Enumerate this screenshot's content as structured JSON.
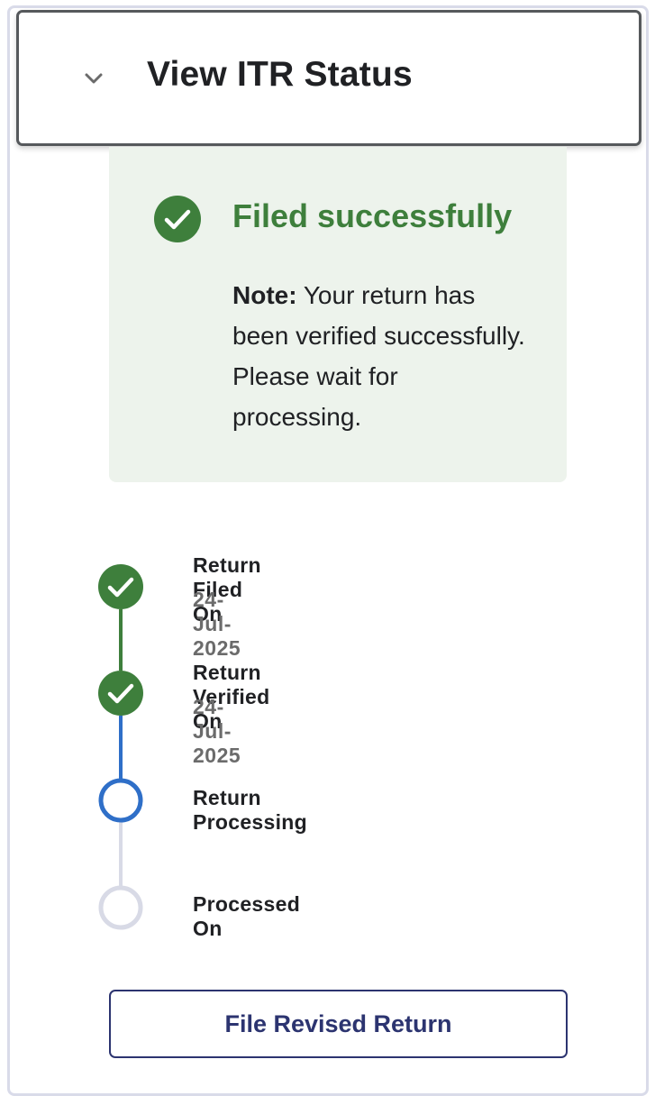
{
  "header": {
    "title": "View ITR Status",
    "toggle_icon": "chevron-down-icon"
  },
  "status_card": {
    "icon": "check-circle-icon",
    "title": "Filed successfully",
    "note_label": "Note:",
    "note_text": " Your return has been verified successfully. Please wait for processing."
  },
  "timeline": {
    "steps": [
      {
        "label": "Return Filed On",
        "date": "24-Jul-2025",
        "state": "completed"
      },
      {
        "label": "Return Verified On",
        "date": "24-Jul-2025",
        "state": "completed"
      },
      {
        "label": "Return Processing",
        "date": "",
        "state": "in-progress"
      },
      {
        "label": "Processed On",
        "date": "",
        "state": "pending"
      }
    ]
  },
  "actions": {
    "file_revised_return_label": "File Revised Return"
  },
  "colors": {
    "success_green": "#3e7f3c",
    "success_bg": "#edf3ec",
    "progress_blue": "#2f6fc8",
    "pending_gray": "#d8dae6",
    "button_navy": "#2c3470"
  }
}
